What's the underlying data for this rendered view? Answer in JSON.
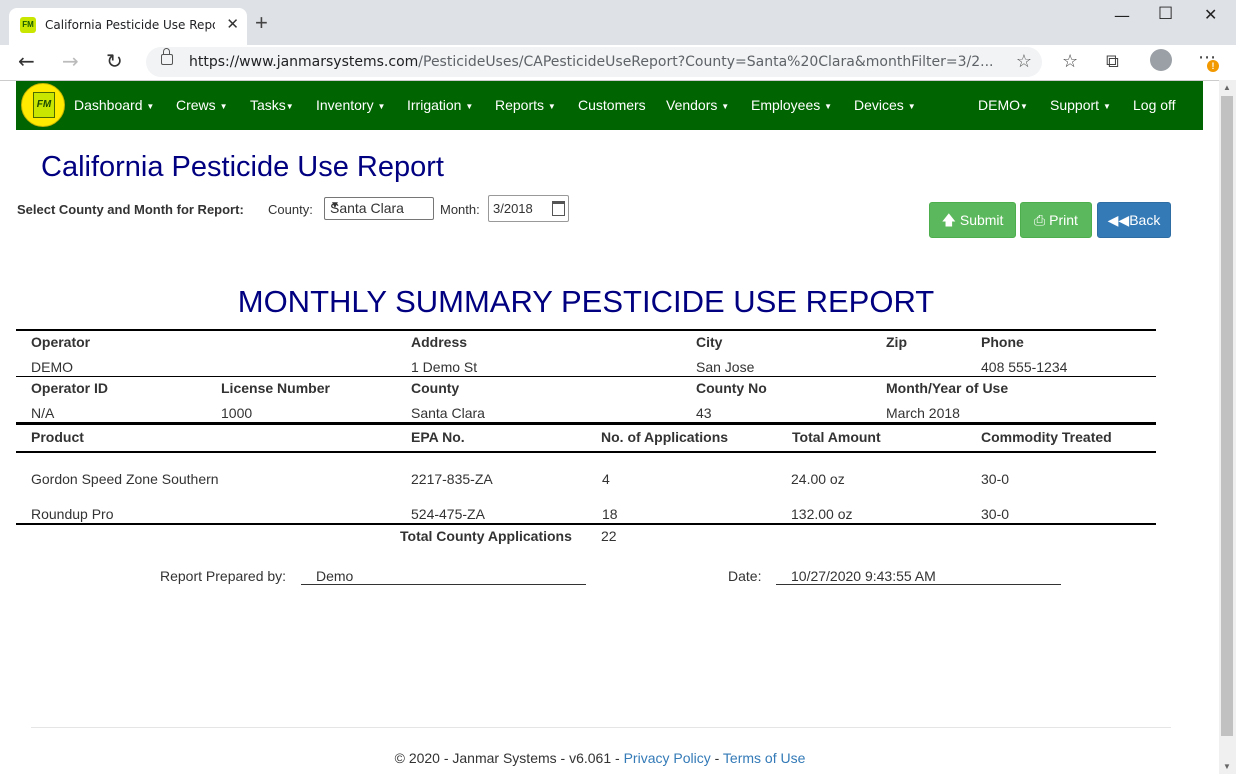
{
  "browser": {
    "tab_title": "California Pesticide Use Report -",
    "favicon_text": "FM",
    "url_host": "https://www.janmarsystems.com",
    "url_path": "/PesticideUses/CAPesticideUseReport?County=Santa%20Clara&monthFilter=3/2..."
  },
  "nav": {
    "logo_text": "FM",
    "items": [
      {
        "label": "Dashboard",
        "caret": true
      },
      {
        "label": "Crews",
        "caret": true
      },
      {
        "label": "Tasks",
        "caret": true
      },
      {
        "label": "Inventory",
        "caret": true
      },
      {
        "label": "Irrigation",
        "caret": true
      },
      {
        "label": "Reports",
        "caret": true
      },
      {
        "label": "Customers",
        "caret": false
      },
      {
        "label": "Vendors",
        "caret": true
      },
      {
        "label": "Employees",
        "caret": true
      },
      {
        "label": "Devices",
        "caret": true
      },
      {
        "label": "DEMO",
        "caret": true
      },
      {
        "label": "Support",
        "caret": true
      },
      {
        "label": "Log off",
        "caret": false
      }
    ]
  },
  "page": {
    "title": "California Pesticide Use Report",
    "filter_label": "Select County and Month for Report:",
    "county_label": "County:",
    "county_value": "Santa Clara",
    "month_label": "Month:",
    "month_value": "3/2018",
    "submit_label": "Submit",
    "print_label": "Print",
    "back_label": "Back"
  },
  "report": {
    "title": "MONTHLY SUMMARY PESTICIDE USE REPORT",
    "operator_header": "Operator",
    "operator": "DEMO",
    "address_header": "Address",
    "address": "1 Demo St",
    "city_header": "City",
    "city": "San Jose",
    "zip_header": "Zip",
    "zip": "",
    "phone_header": "Phone",
    "phone": "408 555-1234",
    "operator_id_header": "Operator ID",
    "operator_id": "N/A",
    "license_header": "License Number",
    "license": "1000",
    "county_header": "County",
    "county": "Santa Clara",
    "county_no_header": "County No",
    "county_no": "43",
    "month_year_header": "Month/Year of Use",
    "month_year": "March 2018",
    "columns": [
      "Product",
      "EPA No.",
      "No. of Applications",
      "Total Amount",
      "Commodity Treated"
    ],
    "rows": [
      [
        "Gordon Speed Zone Southern",
        "2217-835-ZA",
        "4",
        "24.00 oz",
        "30-0"
      ],
      [
        "Roundup Pro",
        "524-475-ZA",
        "18",
        "132.00 oz",
        "30-0"
      ]
    ],
    "total_label": "Total County Applications",
    "total_value": "22",
    "prepared_label": "Report Prepared by:",
    "prepared_value": "Demo",
    "date_label": "Date:",
    "date_value": "10/27/2020 9:43:55 AM"
  },
  "footer": {
    "copyright": "© 2020 - Janmar Systems - v6.061 -",
    "sep": "-",
    "privacy": "Privacy Policy",
    "terms": "Terms of Use"
  }
}
